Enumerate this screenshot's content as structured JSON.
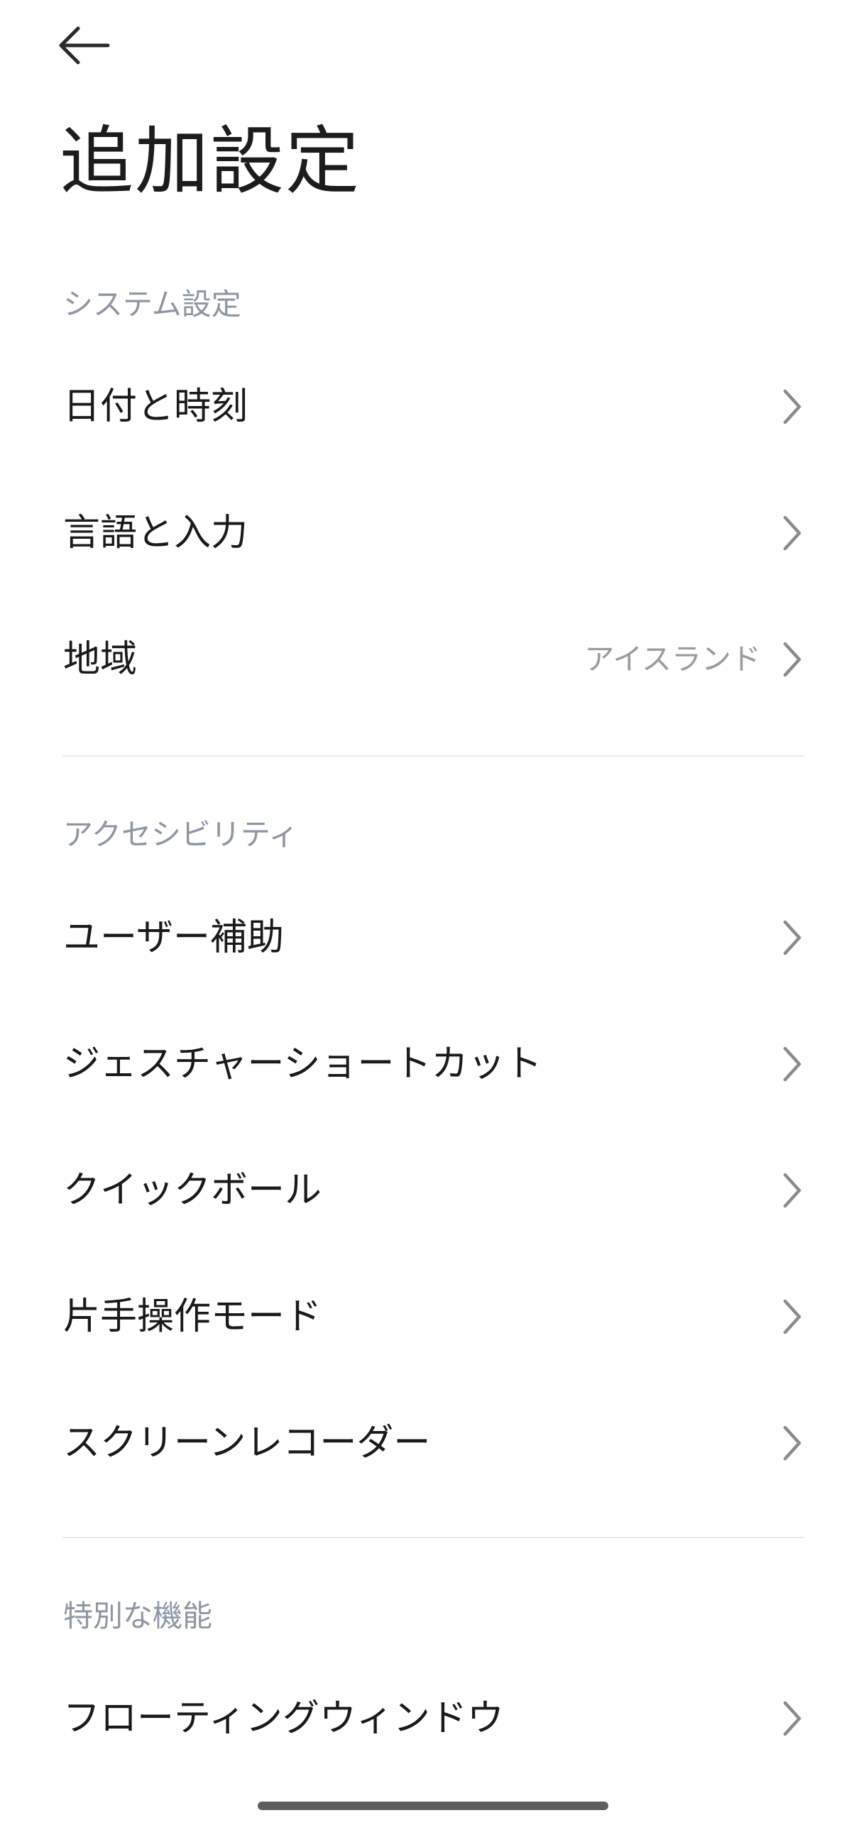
{
  "header": {
    "back_icon": "arrow-left-icon",
    "title": "追加設定"
  },
  "sections": [
    {
      "header": "システム設定",
      "items": [
        {
          "label": "日付と時刻",
          "value": ""
        },
        {
          "label": "言語と入力",
          "value": ""
        },
        {
          "label": "地域",
          "value": "アイスランド"
        }
      ]
    },
    {
      "header": "アクセシビリティ",
      "items": [
        {
          "label": "ユーザー補助",
          "value": ""
        },
        {
          "label": "ジェスチャーショートカット",
          "value": ""
        },
        {
          "label": "クイックボール",
          "value": ""
        },
        {
          "label": "片手操作モード",
          "value": ""
        },
        {
          "label": "スクリーンレコーダー",
          "value": ""
        }
      ]
    },
    {
      "header": "特別な機能",
      "items": [
        {
          "label": "フローティングウィンドウ",
          "value": ""
        }
      ]
    }
  ],
  "icons": {
    "chevron": "chevron-right-icon"
  },
  "colors": {
    "background": "#ffffff",
    "text_primary": "#1a1a1a",
    "section_header": "#8e95a3",
    "secondary_value": "#9b9b9b",
    "chevron": "#8a8a8a",
    "divider": "#e8e8e8"
  }
}
